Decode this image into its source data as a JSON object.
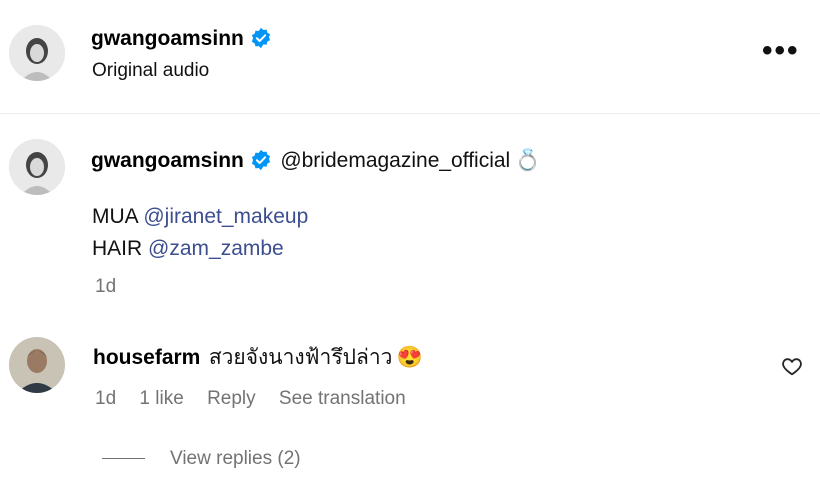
{
  "header": {
    "username": "gwangoamsinn",
    "audio_label": "Original audio",
    "more_label": "•••"
  },
  "caption": {
    "username": "gwangoamsinn",
    "mention": "@bridemagazine_official",
    "emoji": "💍",
    "lines": [
      {
        "prefix": "MUA",
        "mention": "@jiranet_makeup"
      },
      {
        "prefix": "HAIR",
        "mention": "@zam_zambe"
      }
    ],
    "time": "1d"
  },
  "comment": {
    "username": "housefarm",
    "text": "สวยจังนางฟ้ารึปล่าว",
    "emoji": "😍",
    "time": "1d",
    "likes": "1 like",
    "reply_label": "Reply",
    "translate_label": "See translation",
    "view_replies": "View replies (2)"
  },
  "colors": {
    "verified": "#0095f6",
    "mention": "#3c4e8f",
    "meta": "#737373"
  }
}
